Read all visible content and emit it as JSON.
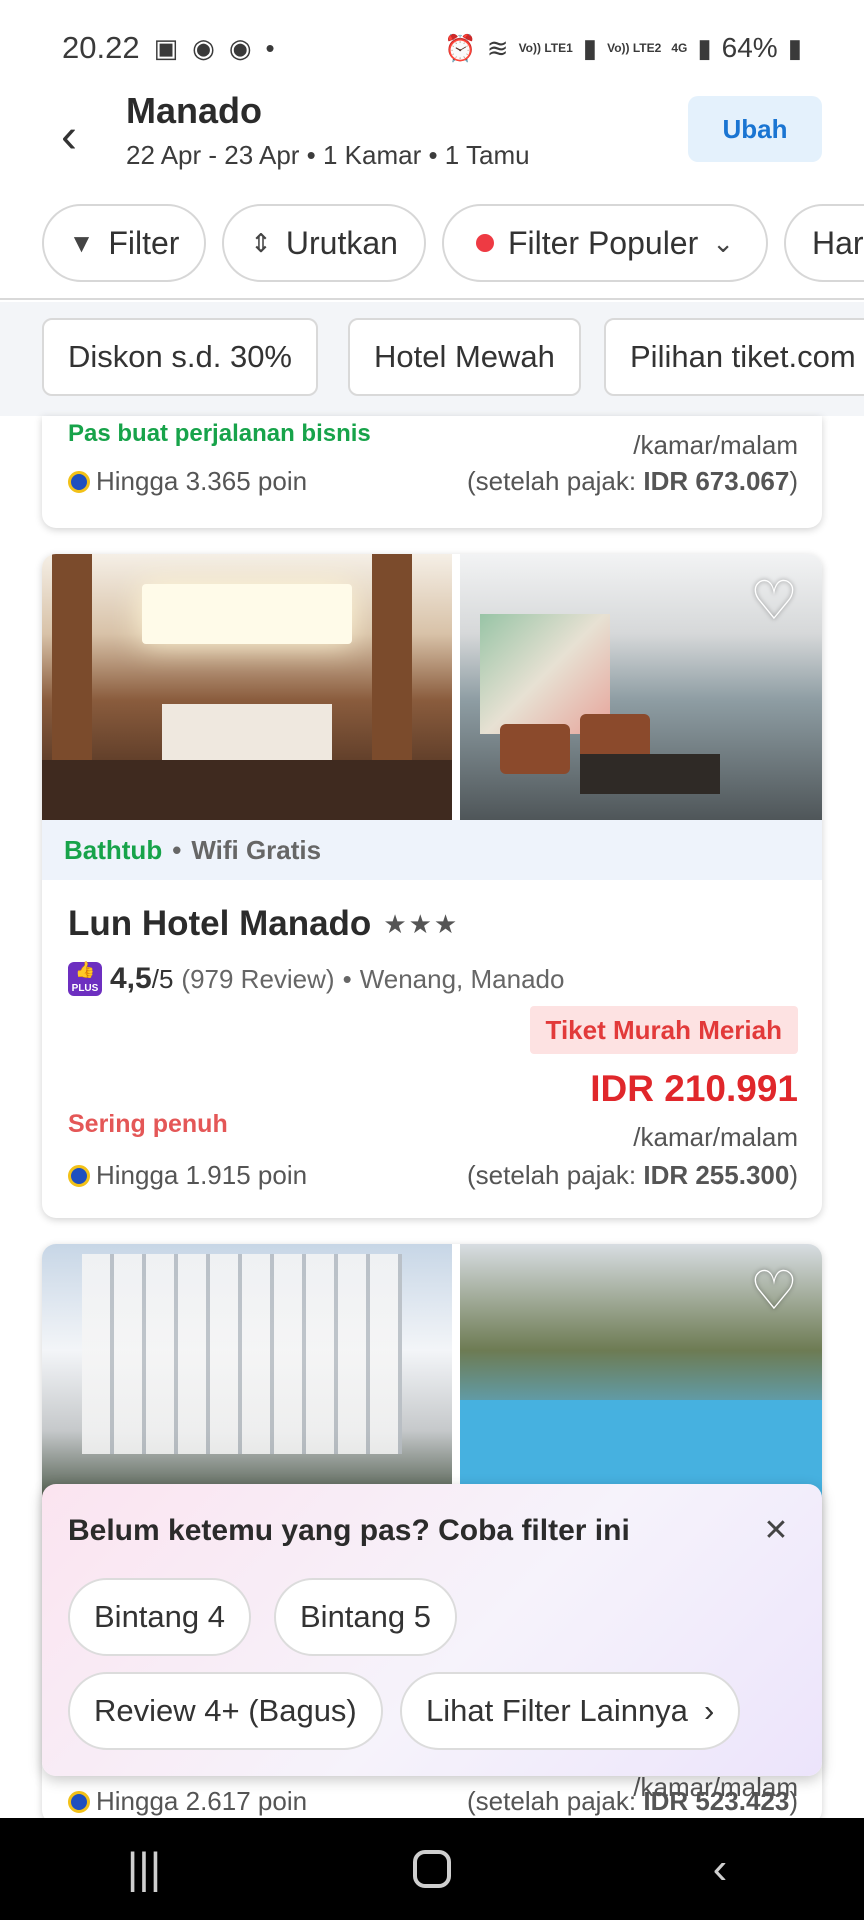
{
  "status_bar": {
    "time": "20.22",
    "battery": "64%",
    "sim1": "Vo)) LTE1",
    "sim2": "Vo)) LTE2",
    "network": "4G"
  },
  "header": {
    "title": "Manado",
    "subtitle": "22 Apr - 23 Apr • 1 Kamar • 1 Tamu",
    "change_label": "Ubah"
  },
  "filters": {
    "filter_label": "Filter",
    "sort_label": "Urutkan",
    "popular_label": "Filter Populer",
    "price_label": "Harga"
  },
  "quick_filters": [
    "Diskon s.d. 30%",
    "Hotel Mewah",
    "Pilihan tiket.com"
  ],
  "previous_card": {
    "note": "Pas buat perjalanan bisnis",
    "per_night": "/kamar/malam",
    "points": "Hingga 3.365 poin",
    "tax_prefix": "(setelah pajak: ",
    "tax_value": "IDR 673.067",
    "tax_suffix": ")"
  },
  "hotel": {
    "amenity_1": "Bathtub",
    "amenity_2": "Wifi Gratis",
    "name": "Lun Hotel Manado",
    "stars": "★★★",
    "badge": "PLUS",
    "rating": "4,5",
    "rating_scale": "/5",
    "reviews": "(979 Review)",
    "location": "Wenang, Manado",
    "promo": "Tiket Murah Meriah",
    "price": "IDR 210.991",
    "per_night": "/kamar/malam",
    "availability": "Sering penuh",
    "points": "Hingga 1.915 poin",
    "tax_prefix": "(setelah pajak: ",
    "tax_value": "IDR 255.300",
    "tax_suffix": ")"
  },
  "next_card": {
    "per_night": "/kamar/malam",
    "points": "Hingga 2.617 poin",
    "tax_prefix": "(setelah pajak: ",
    "tax_value": "IDR 523.423",
    "tax_suffix": ")"
  },
  "suggestion": {
    "title": "Belum ketemu yang pas? Coba filter ini",
    "chips": [
      "Bintang 4",
      "Bintang 5",
      "Review 4+ (Bagus)",
      "Lihat Filter Lainnya"
    ]
  },
  "colors": {
    "accent_blue": "#1a75d2",
    "price_red": "#e0272b",
    "green": "#17a34a"
  }
}
